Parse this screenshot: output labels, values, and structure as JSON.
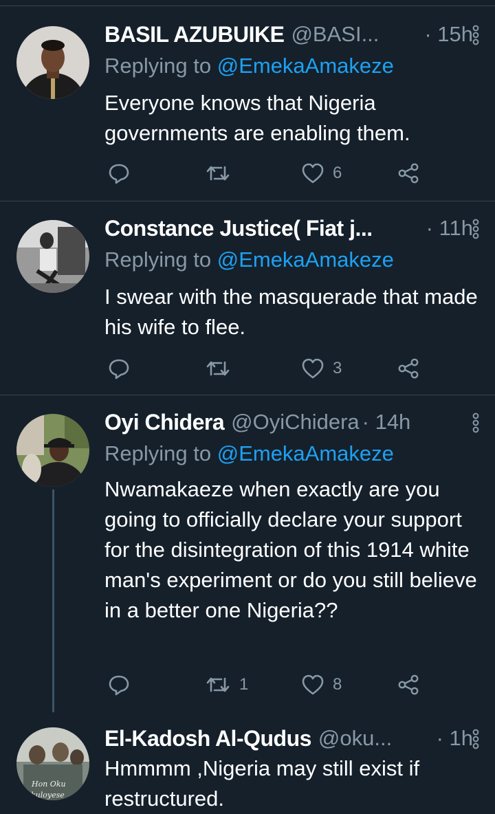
{
  "tweets": [
    {
      "name": "BASIL AZUBUIKE",
      "handle": "@BASI...",
      "time": "· 15h",
      "replying_prefix": "Replying to ",
      "replying_to": "@EmekaAmakeze",
      "text": "Everyone knows that Nigeria governments are enabling them.",
      "replies": "",
      "retweets": "",
      "likes": "6"
    },
    {
      "name": "Constance Justice( Fiat j...",
      "handle": "",
      "time": "· 11h",
      "replying_prefix": "Replying to ",
      "replying_to": "@EmekaAmakeze",
      "text": "I swear with the masquerade that made his wife to flee.",
      "replies": "",
      "retweets": "",
      "likes": "3"
    },
    {
      "name": "Oyi Chidera",
      "handle": "@OyiChidera",
      "time": "· 14h",
      "replying_prefix": "Replying to ",
      "replying_to": "@EmekaAmakeze",
      "text": "Nwamakaeze when exactly are you going to officially declare your support for the disintegration of this 1914 white man's experiment or do you still believe in a better one Nigeria??",
      "replies": "",
      "retweets": "1",
      "likes": "8"
    },
    {
      "name": "El-Kadosh Al-Qudus",
      "handle": "@oku...",
      "time": "· 1h",
      "text": "Hmmmm ,Nigeria may still exist if restructured.",
      "avatar_caption": "Hon Oku Okuloyese"
    }
  ],
  "colors": {
    "background": "#15202b",
    "secondary_text": "#8899a6",
    "link": "#1da1f2",
    "divider": "#38444d"
  }
}
